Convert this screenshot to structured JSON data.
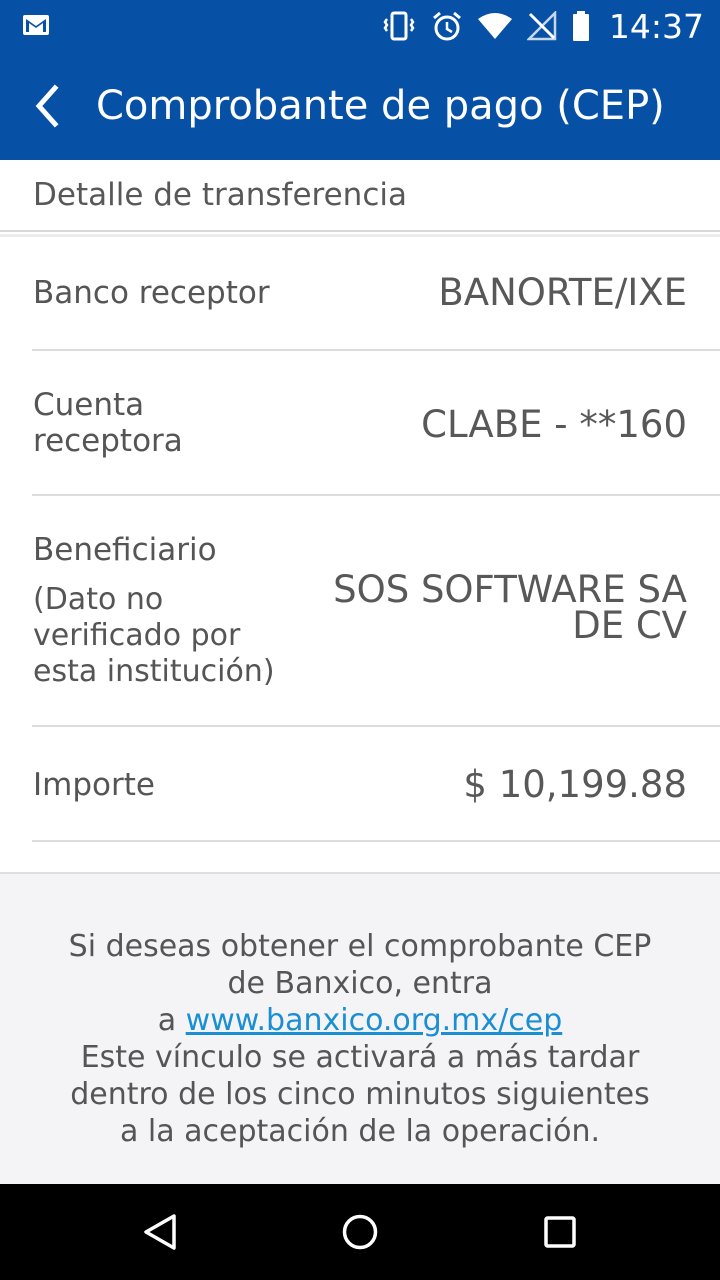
{
  "status_bar": {
    "time": "14:37",
    "icons": [
      "gmail-icon",
      "vibrate-icon",
      "alarm-icon",
      "wifi-icon",
      "no-signal-icon",
      "battery-icon"
    ]
  },
  "app_bar": {
    "title": "Comprobante de pago (CEP)",
    "back_icon": "chevron-left-icon"
  },
  "section": {
    "title": "Detalle de transferencia"
  },
  "details": {
    "banco": {
      "label": "Banco receptor",
      "value": "BANORTE/IXE"
    },
    "cuenta": {
      "label_line1": "Cuenta",
      "label_line2": "receptora",
      "value": "CLABE - **160"
    },
    "beneficiario": {
      "label": "Beneficiario",
      "sub_line1": "(Dato no",
      "sub_line2": "verificado por",
      "sub_line3": "esta institución)",
      "value_line1": "SOS SOFTWARE SA",
      "value_line2": "DE CV"
    },
    "importe": {
      "label": "Importe",
      "value": "$ 10,199.88"
    }
  },
  "info": {
    "line1": "Si deseas obtener el comprobante CEP",
    "line2": "de Banxico, entra",
    "prefix": "a",
    "link": "www.banxico.org.mx/cep",
    "line4": "Este vínculo se activará a más tardar",
    "line5": "dentro de los cinco minutos siguientes",
    "line6": "a la aceptación de la operación."
  },
  "nav_bar": {
    "icons": [
      "back-triangle-icon",
      "home-circle-icon",
      "recents-square-icon"
    ]
  },
  "colors": {
    "primary": "#0650a6",
    "link": "#1a8fd4",
    "footer_bg": "#f4f4f6"
  }
}
